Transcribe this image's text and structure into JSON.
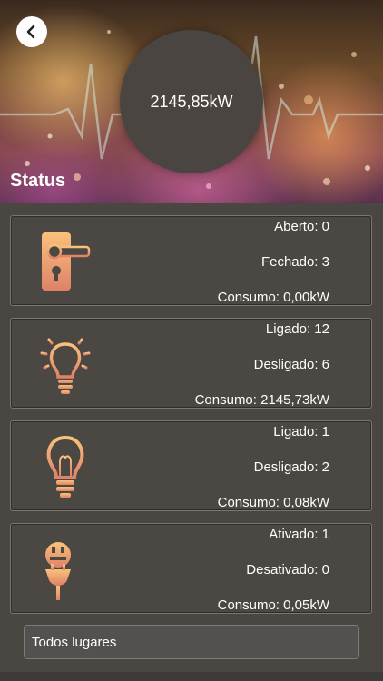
{
  "header": {
    "total": "2145,85kW",
    "title": "Status"
  },
  "cards": [
    {
      "icon": "door-handle-icon",
      "lines": [
        "Aberto: 0",
        "Fechado: 3",
        "Consumo: 0,00kW"
      ]
    },
    {
      "icon": "bulb-on-icon",
      "lines": [
        "Ligado: 12",
        "Desligado: 6",
        "Consumo: 2145,73kW"
      ]
    },
    {
      "icon": "bulb-off-icon",
      "lines": [
        "Ligado: 1",
        "Desligado: 2",
        "Consumo: 0,08kW"
      ]
    },
    {
      "icon": "plug-icon",
      "lines": [
        "Ativado: 1",
        "Desativado: 0",
        "Consumo: 0,05kW"
      ]
    }
  ],
  "location_select": {
    "value": "Todos lugares"
  },
  "colors": {
    "icon_gradient_top": "#f7b86a",
    "icon_gradient_bottom": "#e0836a",
    "background": "#4a4642"
  }
}
